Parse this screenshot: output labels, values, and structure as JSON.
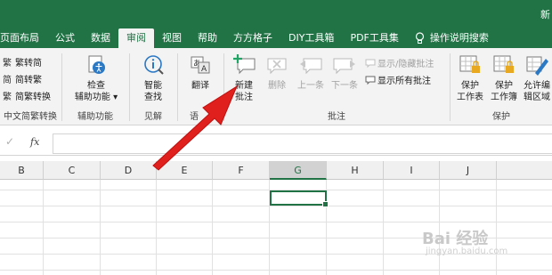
{
  "titlebar": {
    "right_text": "新"
  },
  "tabs": [
    {
      "label": "页面布局"
    },
    {
      "label": "公式"
    },
    {
      "label": "数据"
    },
    {
      "label": "审阅"
    },
    {
      "label": "视图"
    },
    {
      "label": "帮助"
    },
    {
      "label": "方方格子"
    },
    {
      "label": "DIY工具箱"
    },
    {
      "label": "PDF工具集"
    },
    {
      "label": "操作说明搜索"
    }
  ],
  "ribbon": {
    "chinese_convert": {
      "items": [
        "繁转简",
        "简转繁",
        "简繁转换"
      ],
      "group_label": "中文简繁转换"
    },
    "accessibility": {
      "button_line1": "检查",
      "button_line2": "辅助功能 ▾",
      "group_label": "辅助功能"
    },
    "insights": {
      "button_line1": "智能",
      "button_line2": "查找",
      "group_label": "见解"
    },
    "language": {
      "button_line1": "翻译",
      "group_label": "语"
    },
    "comments": {
      "new_line1": "新建",
      "new_line2": "批注",
      "delete": "删除",
      "prev": "上一条",
      "next": "下一条",
      "show_hide": "显示/隐藏批注",
      "show_all": "显示所有批注",
      "group_label": "批注"
    },
    "protect": {
      "sheet_line1": "保护",
      "sheet_line2": "工作表",
      "book_line1": "保护",
      "book_line2": "工作簿",
      "allow_line1": "允许编",
      "allow_line2": "辑区域",
      "group_label": "保护"
    }
  },
  "formula_bar": {
    "fx": "fx",
    "check": "✓",
    "value": ""
  },
  "columns": [
    "B",
    "C",
    "D",
    "E",
    "F",
    "G",
    "H",
    "I",
    "J"
  ],
  "selected_column": "G",
  "watermark": {
    "line1": "Bai 经验",
    "line2": "jingyan.baidu.com"
  },
  "colors": {
    "accent": "#217346",
    "arrow": "#e0201c"
  }
}
